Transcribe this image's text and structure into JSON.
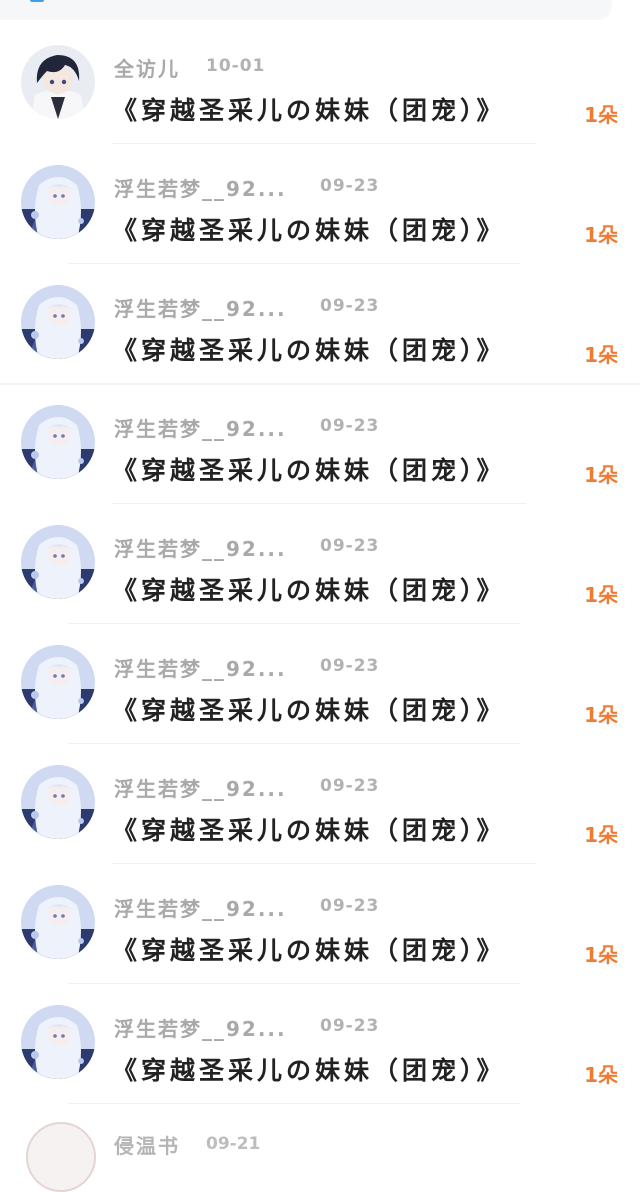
{
  "gift_list": {
    "items": [
      {
        "username": "全访儿",
        "date": "10-01",
        "title": "《穿越圣采儿の妹妹（团宠）》",
        "amount": "1朵",
        "avatar_icon": "avatar-boy-anime-icon"
      },
      {
        "username": "浮生若梦__92...",
        "date": "09-23",
        "title": "《穿越圣采儿の妹妹（团宠）》",
        "amount": "1朵",
        "avatar_icon": "avatar-girl-anime-icon"
      },
      {
        "username": "浮生若梦__92...",
        "date": "09-23",
        "title": "《穿越圣采儿の妹妹（团宠）》",
        "amount": "1朵",
        "avatar_icon": "avatar-girl-anime-icon"
      },
      {
        "username": "浮生若梦__92...",
        "date": "09-23",
        "title": "《穿越圣采儿の妹妹（团宠）》",
        "amount": "1朵",
        "avatar_icon": "avatar-girl-anime-icon"
      },
      {
        "username": "浮生若梦__92...",
        "date": "09-23",
        "title": "《穿越圣采儿の妹妹（团宠）》",
        "amount": "1朵",
        "avatar_icon": "avatar-girl-anime-icon"
      },
      {
        "username": "浮生若梦__92...",
        "date": "09-23",
        "title": "《穿越圣采儿の妹妹（团宠）》",
        "amount": "1朵",
        "avatar_icon": "avatar-girl-anime-icon"
      },
      {
        "username": "浮生若梦__92...",
        "date": "09-23",
        "title": "《穿越圣采儿の妹妹（团宠）》",
        "amount": "1朵",
        "avatar_icon": "avatar-girl-anime-icon"
      },
      {
        "username": "浮生若梦__92...",
        "date": "09-23",
        "title": "《穿越圣采儿の妹妹（团宠）》",
        "amount": "1朵",
        "avatar_icon": "avatar-girl-anime-icon"
      },
      {
        "username": "浮生若梦__92...",
        "date": "09-23",
        "title": "《穿越圣采儿の妹妹（团宠）》",
        "amount": "1朵",
        "avatar_icon": "avatar-girl-anime-icon"
      }
    ],
    "partial_item": {
      "username": "侵温书",
      "date": "09-21"
    }
  },
  "colors": {
    "accent": "#3fa2e8",
    "amount": "#f07a33",
    "title": "#222222",
    "meta": "#a9a9a9"
  }
}
